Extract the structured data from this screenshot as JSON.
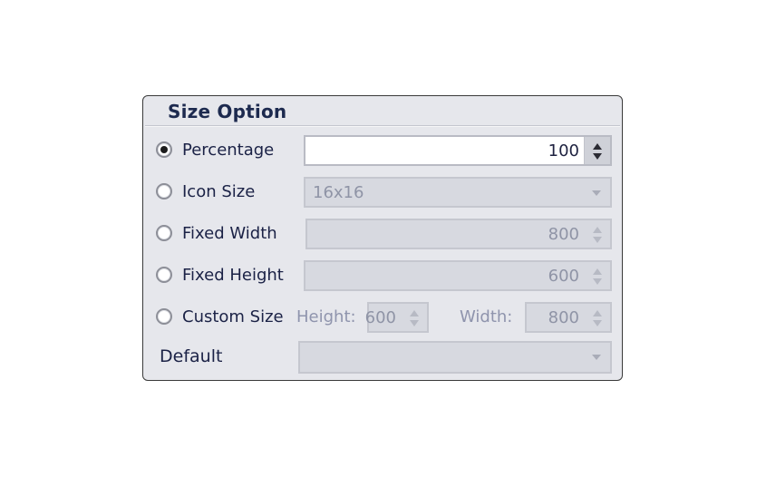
{
  "panel": {
    "title": "Size Option",
    "options": [
      {
        "id": "percentage",
        "label": "Percentage",
        "checked": true,
        "value": "100",
        "control": "spinner",
        "enabled": true
      },
      {
        "id": "icon-size",
        "label": "Icon Size",
        "checked": false,
        "value": "16x16",
        "control": "dropdown",
        "enabled": false
      },
      {
        "id": "fixed-width",
        "label": "Fixed Width",
        "checked": false,
        "value": "800",
        "control": "spinner",
        "enabled": false
      },
      {
        "id": "fixed-height",
        "label": "Fixed Height",
        "checked": false,
        "value": "600",
        "control": "spinner",
        "enabled": false
      },
      {
        "id": "custom-size",
        "label": "Custom Size",
        "checked": false,
        "control": "dual-spinner",
        "enabled": false,
        "height_label": "Height:",
        "height_value": "600",
        "width_label": "Width:",
        "width_value": "800"
      }
    ],
    "default": {
      "label": "Default",
      "value": ""
    }
  }
}
